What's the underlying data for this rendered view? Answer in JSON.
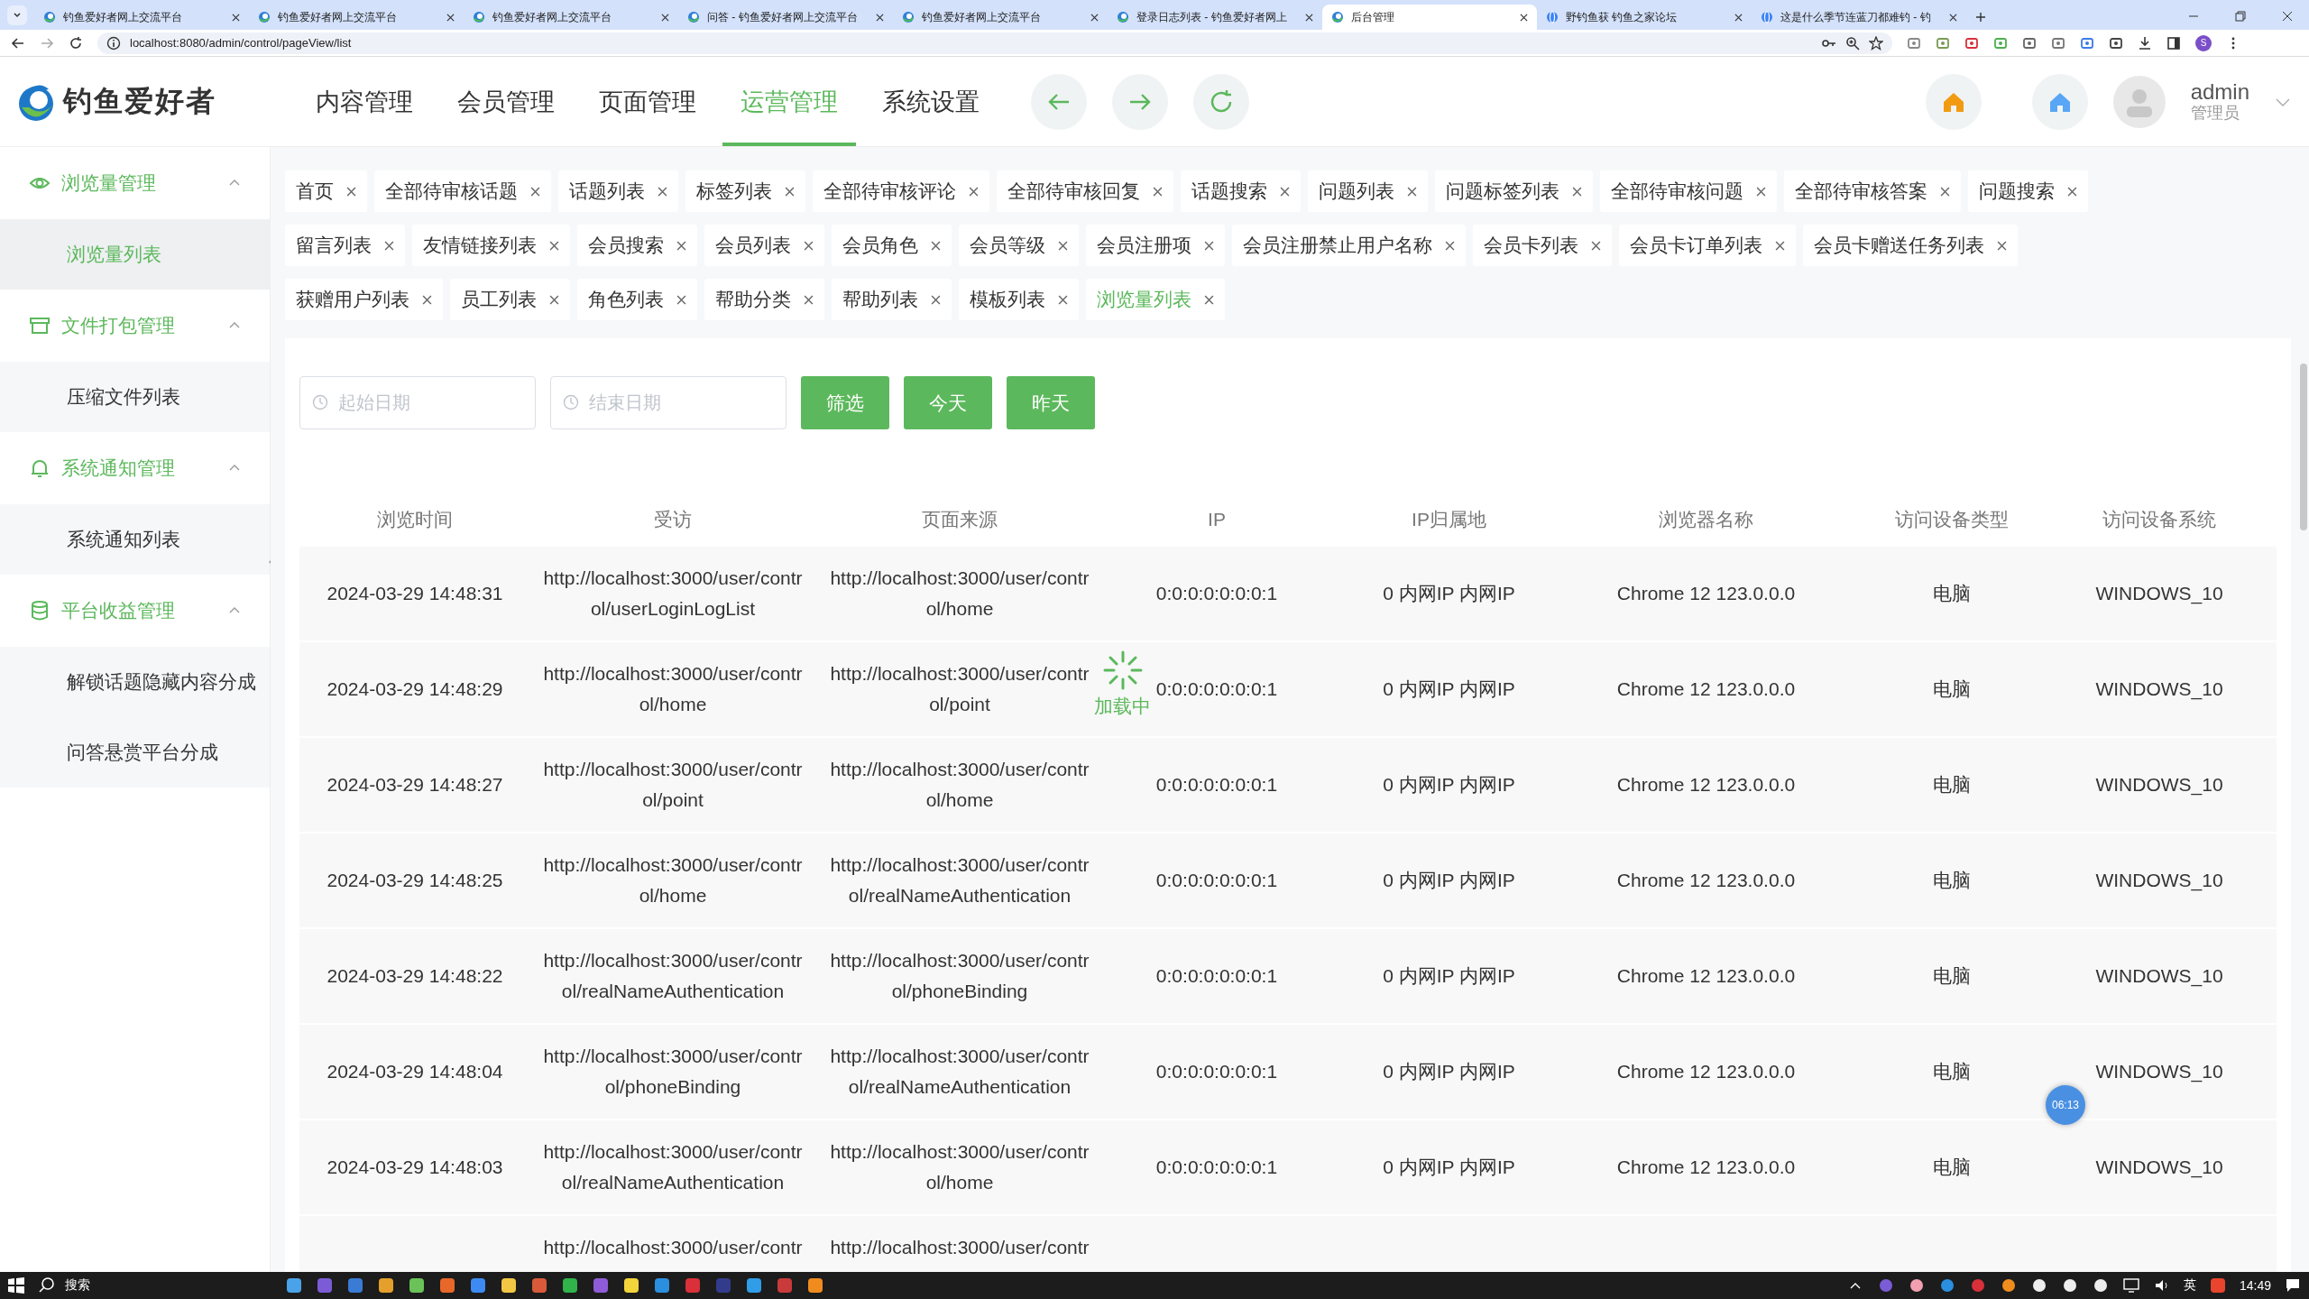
{
  "browser": {
    "tabs": [
      {
        "title": "钓鱼爱好者网上交流平台",
        "selected": false
      },
      {
        "title": "钓鱼爱好者网上交流平台",
        "selected": false
      },
      {
        "title": "钓鱼爱好者网上交流平台",
        "selected": false
      },
      {
        "title": "问答 - 钓鱼爱好者网上交流平台",
        "selected": false
      },
      {
        "title": "钓鱼爱好者网上交流平台",
        "selected": false
      },
      {
        "title": "登录日志列表 - 钓鱼爱好者网上",
        "selected": false
      },
      {
        "title": "后台管理",
        "selected": true
      },
      {
        "title": "野钓鱼获 钓鱼之家论坛",
        "selected": false
      },
      {
        "title": "这是什么季节连蓝刀都难钓 - 钓",
        "selected": false
      }
    ],
    "url": "localhost:8080/admin/control/pageView/list",
    "profile": "S"
  },
  "header": {
    "logo_text": "钓鱼爱好者",
    "nav": [
      {
        "label": "内容管理",
        "selected": false
      },
      {
        "label": "会员管理",
        "selected": false
      },
      {
        "label": "页面管理",
        "selected": false
      },
      {
        "label": "运营管理",
        "selected": true
      },
      {
        "label": "系统设置",
        "selected": false
      }
    ],
    "user": {
      "name": "admin",
      "role": "管理员"
    }
  },
  "sidebar": {
    "groups": [
      {
        "label": "浏览量管理",
        "expanded": true,
        "items": [
          {
            "label": "浏览量列表",
            "selected": true
          }
        ]
      },
      {
        "label": "文件打包管理",
        "expanded": true,
        "items": [
          {
            "label": "压缩文件列表",
            "selected": false
          }
        ]
      },
      {
        "label": "系统通知管理",
        "expanded": true,
        "items": [
          {
            "label": "系统通知列表",
            "selected": false
          }
        ]
      },
      {
        "label": "平台收益管理",
        "expanded": true,
        "items": [
          {
            "label": "解锁话题隐藏内容分成",
            "selected": false
          },
          {
            "label": "问答悬赏平台分成",
            "selected": false
          }
        ]
      }
    ]
  },
  "tag_rows": [
    {
      "tags": [
        {
          "label": "首页",
          "selected": false
        },
        {
          "label": "全部待审核话题",
          "selected": false
        },
        {
          "label": "话题列表",
          "selected": false
        },
        {
          "label": "标签列表",
          "selected": false
        },
        {
          "label": "全部待审核评论",
          "selected": false
        },
        {
          "label": "全部待审核回复",
          "selected": false
        },
        {
          "label": "话题搜索",
          "selected": false
        },
        {
          "label": "问题列表",
          "selected": false
        },
        {
          "label": "问题标签列表",
          "selected": false
        },
        {
          "label": "全部待审核问题",
          "selected": false
        },
        {
          "label": "全部待审核答案",
          "selected": false
        },
        {
          "label": "问题搜索",
          "selected": false
        }
      ]
    },
    {
      "tags": [
        {
          "label": "留言列表",
          "selected": false
        },
        {
          "label": "友情链接列表",
          "selected": false
        },
        {
          "label": "会员搜索",
          "selected": false
        },
        {
          "label": "会员列表",
          "selected": false
        },
        {
          "label": "会员角色",
          "selected": false
        },
        {
          "label": "会员等级",
          "selected": false
        },
        {
          "label": "会员注册项",
          "selected": false
        },
        {
          "label": "会员注册禁止用户名称",
          "selected": false
        },
        {
          "label": "会员卡列表",
          "selected": false
        },
        {
          "label": "会员卡订单列表",
          "selected": false
        },
        {
          "label": "会员卡赠送任务列表",
          "selected": false
        }
      ]
    },
    {
      "tags": [
        {
          "label": "获赠用户列表",
          "selected": false
        },
        {
          "label": "员工列表",
          "selected": false
        },
        {
          "label": "角色列表",
          "selected": false
        },
        {
          "label": "帮助分类",
          "selected": false
        },
        {
          "label": "帮助列表",
          "selected": false
        },
        {
          "label": "模板列表",
          "selected": false
        },
        {
          "label": "浏览量列表",
          "selected": true
        }
      ]
    }
  ],
  "filter": {
    "start_date": {
      "placeholder": "起始日期"
    },
    "end_date": {
      "placeholder": "结束日期"
    },
    "buttons": [
      "筛选",
      "今天",
      "昨天"
    ]
  },
  "table": {
    "columns": [
      "浏览时间",
      "受访",
      "页面来源",
      "IP",
      "IP归属地",
      "浏览器名称",
      "访问设备类型",
      "访问设备系统"
    ],
    "rows": [
      {
        "time": "2024-03-29 14:48:31",
        "visited": "http://localhost:3000/user/control/userLoginLogList",
        "source": "http://localhost:3000/user/control/home",
        "ip": "0:0:0:0:0:0:0:1",
        "ip_location": "0 内网IP 内网IP",
        "browser": "Chrome 12 123.0.0.0",
        "device_type": "电脑",
        "device_os": "WINDOWS_10"
      },
      {
        "time": "2024-03-29 14:48:29",
        "visited": "http://localhost:3000/user/control/home",
        "source": "http://localhost:3000/user/control/point",
        "ip": "0:0:0:0:0:0:0:1",
        "ip_location": "0 内网IP 内网IP",
        "browser": "Chrome 12 123.0.0.0",
        "device_type": "电脑",
        "device_os": "WINDOWS_10"
      },
      {
        "time": "2024-03-29 14:48:27",
        "visited": "http://localhost:3000/user/control/point",
        "source": "http://localhost:3000/user/control/home",
        "ip": "0:0:0:0:0:0:0:1",
        "ip_location": "0 内网IP 内网IP",
        "browser": "Chrome 12 123.0.0.0",
        "device_type": "电脑",
        "device_os": "WINDOWS_10"
      },
      {
        "time": "2024-03-29 14:48:25",
        "visited": "http://localhost:3000/user/control/home",
        "source": "http://localhost:3000/user/control/realNameAuthentication",
        "ip": "0:0:0:0:0:0:0:1",
        "ip_location": "0 内网IP 内网IP",
        "browser": "Chrome 12 123.0.0.0",
        "device_type": "电脑",
        "device_os": "WINDOWS_10"
      },
      {
        "time": "2024-03-29 14:48:22",
        "visited": "http://localhost:3000/user/control/realNameAuthentication",
        "source": "http://localhost:3000/user/control/phoneBinding",
        "ip": "0:0:0:0:0:0:0:1",
        "ip_location": "0 内网IP 内网IP",
        "browser": "Chrome 12 123.0.0.0",
        "device_type": "电脑",
        "device_os": "WINDOWS_10"
      },
      {
        "time": "2024-03-29 14:48:04",
        "visited": "http://localhost:3000/user/control/phoneBinding",
        "source": "http://localhost:3000/user/control/realNameAuthentication",
        "ip": "0:0:0:0:0:0:0:1",
        "ip_location": "0 内网IP 内网IP",
        "browser": "Chrome 12 123.0.0.0",
        "device_type": "电脑",
        "device_os": "WINDOWS_10"
      },
      {
        "time": "2024-03-29 14:48:03",
        "visited": "http://localhost:3000/user/control/realNameAuthentication",
        "source": "http://localhost:3000/user/control/home",
        "ip": "0:0:0:0:0:0:0:1",
        "ip_location": "0 内网IP 内网IP",
        "browser": "Chrome 12 123.0.0.0",
        "device_type": "电脑",
        "device_os": "WINDOWS_10"
      },
      {
        "visited": "http://localhost:3000/user/contr",
        "source": "http://localhost:3000/user/contr"
      }
    ]
  },
  "loading": {
    "label": "加载中"
  },
  "recorder_badge": "06:13",
  "taskbar": {
    "search": "搜索",
    "ime": "英",
    "clock": "14:49"
  }
}
